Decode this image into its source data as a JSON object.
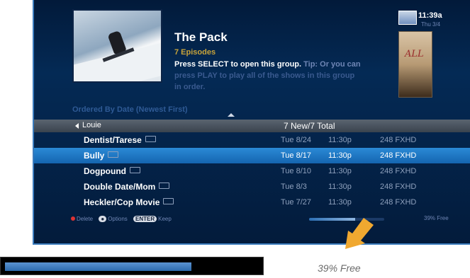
{
  "show": {
    "title": "The Pack",
    "episode_count": "7 Episodes",
    "instruction": "Press SELECT to open this group.",
    "tip": "Tip: Or you can",
    "tip_more": "press PLAY to play all of the shows in this group",
    "tip_tail": "in order."
  },
  "header": {
    "time": "11:39a",
    "date": "Thu 3/4"
  },
  "poster": {
    "title_text": "ALL"
  },
  "sort_label": "Ordered By Date (Newest First)",
  "group": {
    "name": "Louie",
    "count": "7 New/7 Total"
  },
  "recordings": [
    {
      "name": "Dentist/Tarese",
      "date": "Tue 8/24",
      "time": "11:30p",
      "channel": "248 FXHD",
      "selected": false
    },
    {
      "name": "Bully",
      "date": "Tue 8/17",
      "time": "11:30p",
      "channel": "248 FXHD",
      "selected": true
    },
    {
      "name": "Dogpound",
      "date": "Tue 8/10",
      "time": "11:30p",
      "channel": "248 FXHD",
      "selected": false
    },
    {
      "name": "Double Date/Mom",
      "date": "Tue 8/3",
      "time": "11:30p",
      "channel": "248 FXHD",
      "selected": false
    },
    {
      "name": "Heckler/Cop Movie",
      "date": "Tue 7/27",
      "time": "11:30p",
      "channel": "248 FXHD",
      "selected": false
    }
  ],
  "legend": {
    "delete": "Delete",
    "options": "Options",
    "enter_key": "ENTER",
    "keep": "Keep"
  },
  "disk": {
    "free_label": "39% Free",
    "used_fraction": 0.61
  },
  "callout": {
    "caption": "39% Free",
    "used_fraction": 0.73,
    "arrow_color": "#f0a830"
  },
  "colors": {
    "accent": "#1565b0",
    "title": "#ffffff",
    "episodes": "#c8a33a"
  }
}
